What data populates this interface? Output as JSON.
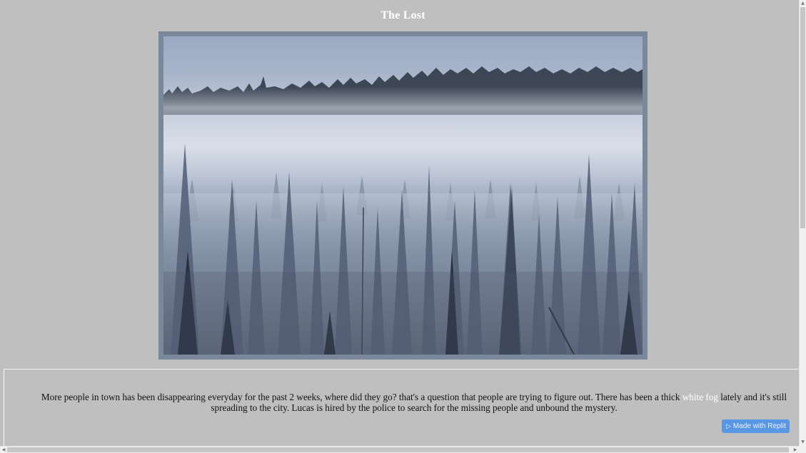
{
  "page": {
    "title": "The Lost"
  },
  "photo": {
    "subject": "foggy-pine-forest-image"
  },
  "story": {
    "text_before": "More people in town has been disappearing everyday for the past 2 weeks, where did they go? that's a question that people are trying to figure out. There has been a thick ",
    "highlight": "white fog",
    "text_after": " lately and it's still spreading to the city. Lucas is hired by the police to search for the missing people and unbound the mystery."
  },
  "badge": {
    "label": "Made with Replit",
    "icon": "replit-icon"
  },
  "colors": {
    "background": "#c0bfbf",
    "frame": "#7b889c",
    "title": "#ffffff",
    "highlight": "#ffffff",
    "badge": "#5a97e3"
  }
}
